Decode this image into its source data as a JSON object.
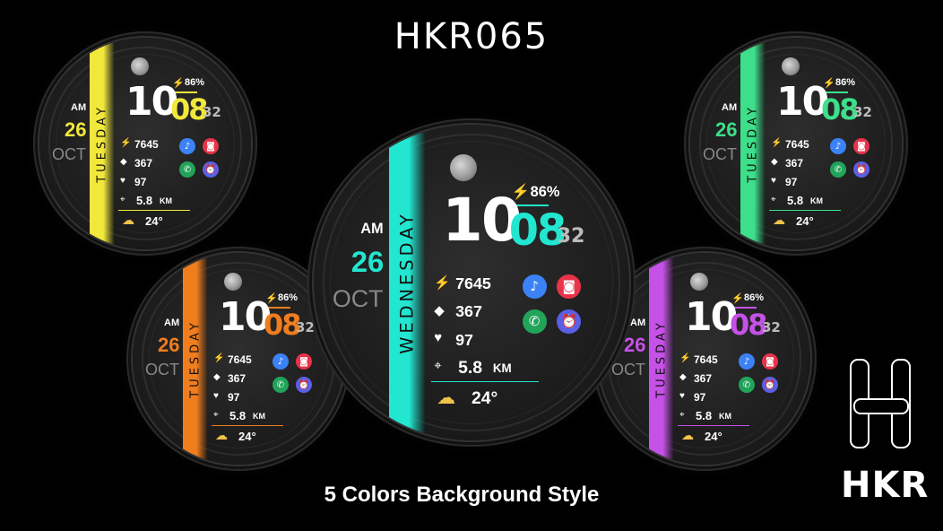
{
  "title": "HKR065",
  "subtitle": "5 Colors Background Style",
  "logo_text": "HKR",
  "watches": [
    {
      "id": "yellow",
      "accent": "#f1e83c",
      "day": "TUESDAY",
      "ampm": "AM",
      "date": "26",
      "month": "OCT",
      "hour": "10",
      "minute": "08",
      "second": "32",
      "battery": "86%",
      "steps": "7645",
      "calories": "367",
      "heart": "97",
      "distance": "5.8",
      "distance_unit": "KM",
      "temp": "24°",
      "shortcut_icons": [
        "music-icon",
        "camera-icon",
        "phone-icon",
        "alarm-icon"
      ]
    },
    {
      "id": "green",
      "accent": "#3ddf8a",
      "day": "TUESDAY",
      "ampm": "AM",
      "date": "26",
      "month": "OCT",
      "hour": "10",
      "minute": "08",
      "second": "32",
      "battery": "86%",
      "steps": "7645",
      "calories": "367",
      "heart": "97",
      "distance": "5.8",
      "distance_unit": "KM",
      "temp": "24°"
    },
    {
      "id": "orange",
      "accent": "#f07d1e",
      "day": "TUESDAY",
      "ampm": "AM",
      "date": "26",
      "month": "OCT",
      "hour": "10",
      "minute": "08",
      "second": "32",
      "battery": "86%",
      "steps": "7645",
      "calories": "367",
      "heart": "97",
      "distance": "5.8",
      "distance_unit": "KM",
      "temp": "24°"
    },
    {
      "id": "purple",
      "accent": "#c651e8",
      "day": "TUESDAY",
      "ampm": "AM",
      "date": "26",
      "month": "OCT",
      "hour": "10",
      "minute": "08",
      "second": "32",
      "battery": "86%",
      "steps": "7645",
      "calories": "367",
      "heart": "97",
      "distance": "5.8",
      "distance_unit": "KM",
      "temp": "24°"
    },
    {
      "id": "teal",
      "accent": "#22e6d0",
      "day": "WEDNESDAY",
      "ampm": "AM",
      "date": "26",
      "month": "OCT",
      "hour": "10",
      "minute": "08",
      "second": "32",
      "battery": "86%",
      "steps": "7645",
      "calories": "367",
      "heart": "97",
      "distance": "5.8",
      "distance_unit": "KM",
      "temp": "24°"
    }
  ],
  "colors": {
    "music": "#3b82f6",
    "camera": "#e8334a",
    "phone": "#21a35a",
    "alarm": "#5b5fe6"
  }
}
